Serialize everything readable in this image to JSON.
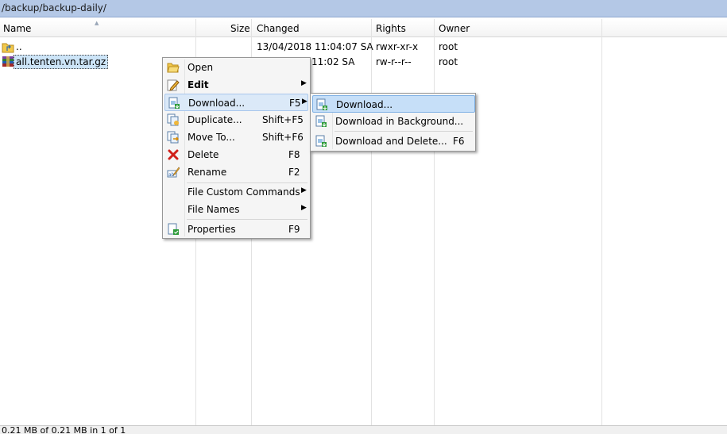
{
  "path": "/backup/backup-daily/",
  "columns": {
    "name": "Name",
    "size": "Size",
    "changed": "Changed",
    "rights": "Rights",
    "owner": "Owner"
  },
  "rows": [
    {
      "name": "..",
      "size": "",
      "changed": "13/04/2018 11:04:07 SA",
      "rights": "rwxr-xr-x",
      "owner": "root",
      "icon": "parent-folder-icon"
    },
    {
      "name": "all.tenten.vn.tar.gz",
      "size": "",
      "changed": "11:02 SA",
      "rights": "rw-r--r--",
      "owner": "root",
      "icon": "archive-icon"
    }
  ],
  "context_menu": {
    "open": "Open",
    "edit": "Edit",
    "download": "Download...",
    "download_sc": "F5",
    "duplicate": "Duplicate...",
    "duplicate_sc": "Shift+F5",
    "move": "Move To...",
    "move_sc": "Shift+F6",
    "delete": "Delete",
    "delete_sc": "F8",
    "rename": "Rename",
    "rename_sc": "F2",
    "custom": "File Custom Commands",
    "names": "File Names",
    "properties": "Properties",
    "properties_sc": "F9"
  },
  "submenu": {
    "download": "Download...",
    "background": "Download in Background...",
    "delete": "Download and Delete...",
    "delete_sc": "F6"
  },
  "status": "0.21 MB of 0.21 MB in 1 of 1",
  "colors": {
    "accent": "#c6dff8",
    "pathbar": "#b4c8e6"
  }
}
